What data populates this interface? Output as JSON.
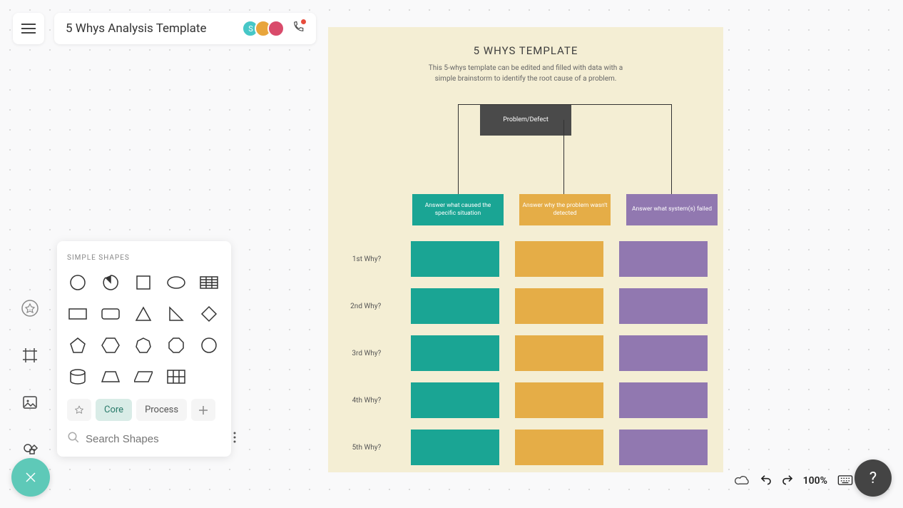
{
  "header": {
    "doc_title": "5 Whys Analysis Template",
    "avatar_initial": "S"
  },
  "shapes_panel": {
    "title": "SIMPLE SHAPES",
    "tabs": {
      "pin": "",
      "core": "Core",
      "process": "Process"
    },
    "search_placeholder": "Search Shapes"
  },
  "template": {
    "title": "5 WHYS TEMPLATE",
    "subtitle": "This 5-whys template can be edited and filled with data with a simple brainstorm to identify the root cause of a problem.",
    "defect_label": "Problem/Defect",
    "columns": [
      "Answer what caused the specific situation",
      "Answer why the problem wasn't detected",
      "Answer what system(s) failed"
    ],
    "rows": [
      "1st Why?",
      "2nd Why?",
      "3rd Why?",
      "4th Why?",
      "5th Why?"
    ]
  },
  "footer": {
    "zoom": "100%",
    "help": "?"
  },
  "colors": {
    "teal": "#1aa594",
    "amber": "#e5ad47",
    "purple": "#9178b0",
    "defect": "#4a4a4a",
    "canvas_bg": "#f4eed4"
  }
}
